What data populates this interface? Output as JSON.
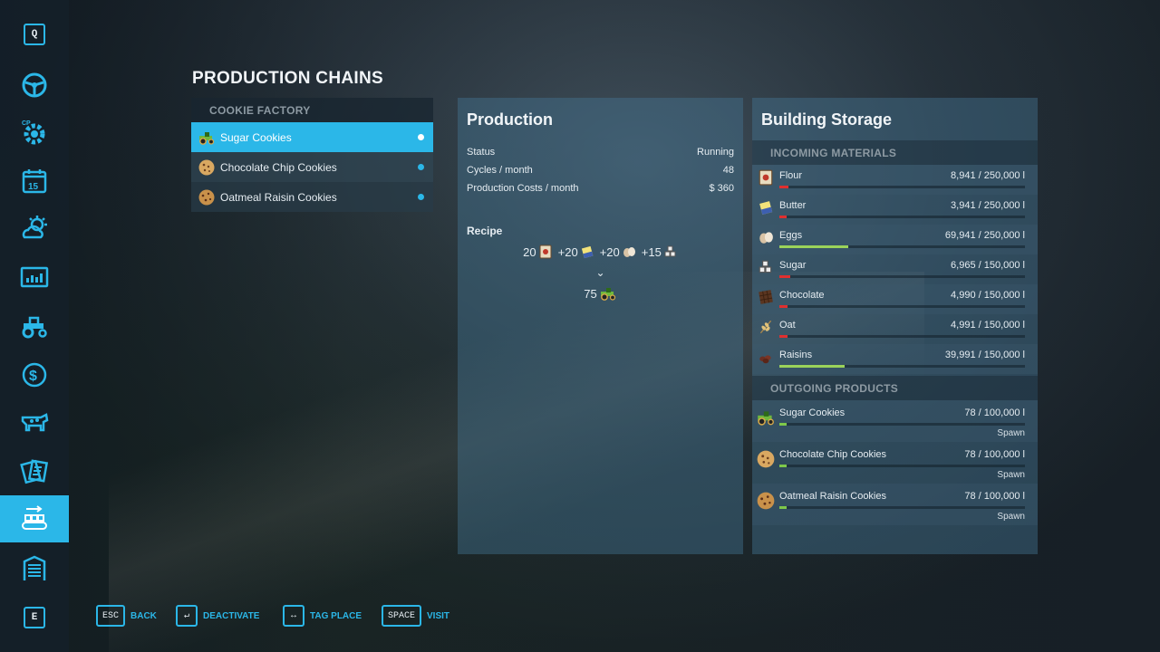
{
  "colors": {
    "accent": "#2bb7e8",
    "bar_low": "#e02f2f",
    "bar_mid": "#9bd35a",
    "bar_out": "#7ec84a"
  },
  "sidebar": {
    "top_key": "Q",
    "bottom_key": "E",
    "items": [
      {
        "icon": "steering-wheel-icon"
      },
      {
        "icon": "gear-cp-icon"
      },
      {
        "icon": "calendar-icon",
        "label": "15"
      },
      {
        "icon": "weather-icon"
      },
      {
        "icon": "prices-chart-icon"
      },
      {
        "icon": "tractor-icon"
      },
      {
        "icon": "finances-dollar-icon"
      },
      {
        "icon": "animals-cow-icon"
      },
      {
        "icon": "contracts-icon"
      },
      {
        "icon": "production-conveyor-icon",
        "active": true
      },
      {
        "icon": "garage-icon"
      }
    ]
  },
  "page": {
    "title": "PRODUCTION CHAINS"
  },
  "chains": {
    "group": "COOKIE FACTORY",
    "items": [
      {
        "label": "Sugar Cookies",
        "icon": "tractor-cookie-icon",
        "selected": true
      },
      {
        "label": "Chocolate Chip Cookies",
        "icon": "cookie-icon",
        "selected": false
      },
      {
        "label": "Oatmeal Raisin Cookies",
        "icon": "cookie-icon",
        "selected": false
      }
    ]
  },
  "production": {
    "title": "Production",
    "status_label": "Status",
    "status_value": "Running",
    "cycles_label": "Cycles / month",
    "cycles_value": "48",
    "costs_label": "Production Costs / month",
    "costs_value": "$ 360",
    "recipe_label": "Recipe",
    "inputs": [
      {
        "prefix": "20",
        "icon": "flour-icon"
      },
      {
        "prefix": "+20",
        "icon": "butter-icon"
      },
      {
        "prefix": "+20",
        "icon": "eggs-icon"
      },
      {
        "prefix": "+15",
        "icon": "sugar-icon"
      }
    ],
    "arrow": "⌄",
    "output": {
      "amount": "75",
      "icon": "tractor-cookie-icon"
    }
  },
  "storage": {
    "title": "Building Storage",
    "incoming_header": "INCOMING MATERIALS",
    "incoming": [
      {
        "name": "Flour",
        "amount": "8,941  / 250,000 l",
        "fill": 0.036,
        "icon": "flour-icon"
      },
      {
        "name": "Butter",
        "amount": "3,941  / 250,000 l",
        "fill": 0.016,
        "icon": "butter-icon"
      },
      {
        "name": "Eggs",
        "amount": "69,941  / 250,000 l",
        "fill": 0.28,
        "icon": "eggs-icon"
      },
      {
        "name": "Sugar",
        "amount": "6,965  / 150,000 l",
        "fill": 0.046,
        "icon": "sugar-icon"
      },
      {
        "name": "Chocolate",
        "amount": "4,990  / 150,000 l",
        "fill": 0.033,
        "icon": "chocolate-icon"
      },
      {
        "name": "Oat",
        "amount": "4,991  / 150,000 l",
        "fill": 0.033,
        "icon": "oat-icon"
      },
      {
        "name": "Raisins",
        "amount": "39,991  / 150,000 l",
        "fill": 0.267,
        "icon": "raisins-icon"
      }
    ],
    "outgoing_header": "OUTGOING PRODUCTS",
    "outgoing": [
      {
        "name": "Sugar Cookies",
        "amount": "78  / 100,000 l",
        "fill": 0.008,
        "mode": "Spawn",
        "icon": "tractor-cookie-icon"
      },
      {
        "name": "Chocolate Chip Cookies",
        "amount": "78  / 100,000 l",
        "fill": 0.008,
        "mode": "Spawn",
        "icon": "cookie-icon"
      },
      {
        "name": "Oatmeal Raisin Cookies",
        "amount": "78  / 100,000 l",
        "fill": 0.008,
        "mode": "Spawn",
        "icon": "cookie-icon"
      }
    ]
  },
  "hints": [
    {
      "key": "ESC",
      "label": "BACK"
    },
    {
      "key": "↵",
      "label": "DEACTIVATE"
    },
    {
      "key": "↔",
      "label": "TAG PLACE"
    },
    {
      "key": "SPACE",
      "label": "VISIT"
    }
  ]
}
